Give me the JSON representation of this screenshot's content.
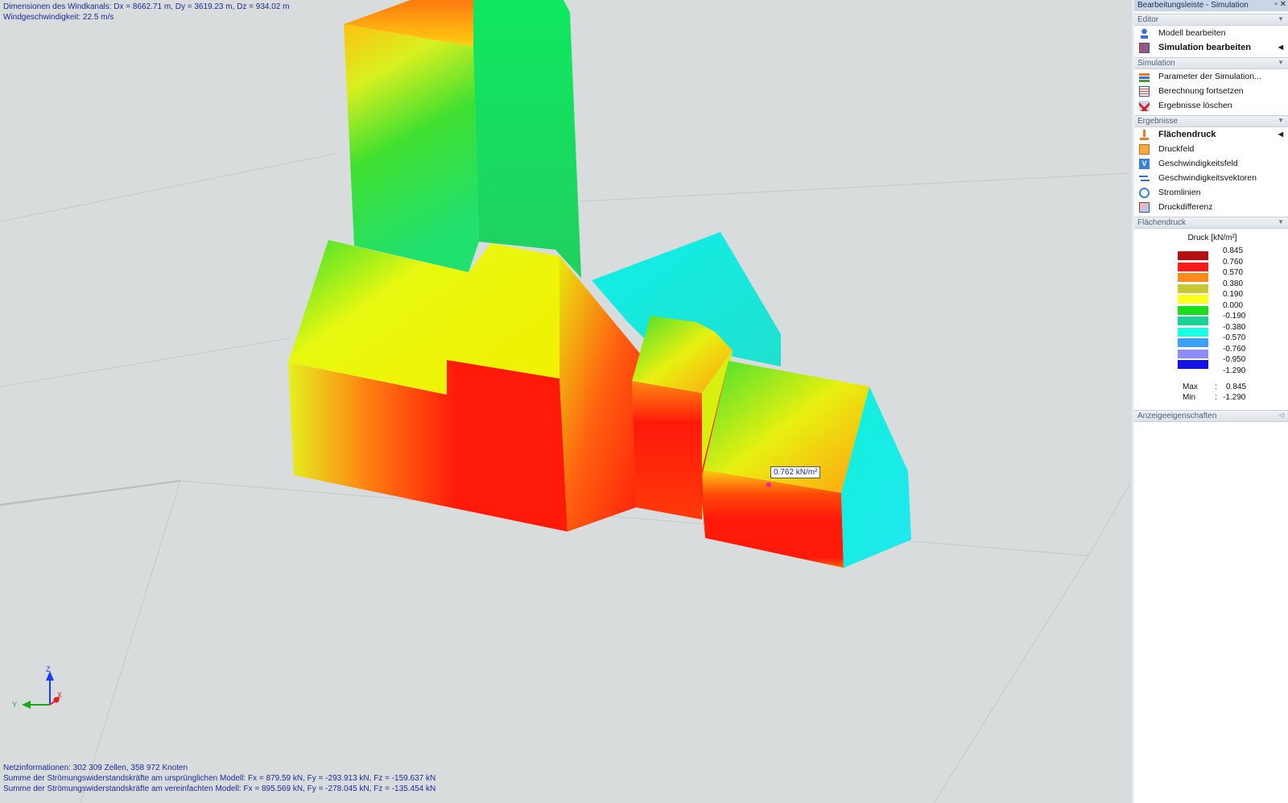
{
  "viewport": {
    "tunnel_dimensions": "Dimensionen des Windkanals: Dx = 8662.71 m, Dy = 3619.23 m, Dz = 934.02 m",
    "wind_speed": "Windgeschwindigkeit: 22.5 m/s",
    "mesh_info": "Netzinformationen: 302 309 Zellen, 358 972 Knoten",
    "drag_original": "Summe der Strömungswiderstandskräfte am ursprünglichen Modell: Fx = 879.59 kN, Fy = -293.913 kN, Fz = -159.637 kN",
    "drag_simplified": "Summe der Strömungswiderstandskräfte am vereinfachten Modell: Fx = 895.569 kN, Fy = -278.045 kN, Fz = -135.454 kN",
    "probe_value": "0.762 kN/m²",
    "axes": {
      "z": "Z",
      "y": "Y",
      "x": "X"
    }
  },
  "panel": {
    "title": "Bearbeitungsleiste - Simulation",
    "controls": "▫ ✕",
    "sections": {
      "editor": {
        "label": "Editor",
        "items": [
          {
            "label": "Modell bearbeiten",
            "icon": "model-edit-icon"
          },
          {
            "label": "Simulation bearbeiten",
            "icon": "simulation-edit-icon"
          }
        ]
      },
      "simulation": {
        "label": "Simulation",
        "items": [
          {
            "label": "Parameter der Simulation...",
            "icon": "parameters-icon"
          },
          {
            "label": "Berechnung fortsetzen",
            "icon": "continue-calc-icon"
          },
          {
            "label": "Ergebnisse löschen",
            "icon": "delete-results-icon"
          }
        ]
      },
      "results": {
        "label": "Ergebnisse",
        "items": [
          {
            "label": "Flächendruck",
            "icon": "surface-pressure-icon"
          },
          {
            "label": "Druckfeld",
            "icon": "pressure-field-icon"
          },
          {
            "label": "Geschwindigkeitsfeld",
            "icon": "velocity-field-icon"
          },
          {
            "label": "Geschwindigkeitsvektoren",
            "icon": "velocity-vectors-icon"
          },
          {
            "label": "Stromlinien",
            "icon": "streamlines-icon"
          },
          {
            "label": "Druckdifferenz",
            "icon": "pressure-difference-icon"
          }
        ]
      },
      "surface_pressure": {
        "label": "Flächendruck",
        "legend_title": "Druck [kN/m²]",
        "legend": [
          {
            "value": "0.845",
            "color": "#b50f14"
          },
          {
            "value": "0.760",
            "color": "#ff1a1a"
          },
          {
            "value": "0.570",
            "color": "#ff8a1a"
          },
          {
            "value": "0.380",
            "color": "#c8c832"
          },
          {
            "value": "0.190",
            "color": "#ffff1a"
          },
          {
            "value": "0.000",
            "color": "#1ade1a"
          },
          {
            "value": "-0.190",
            "color": "#1ad296"
          },
          {
            "value": "-0.380",
            "color": "#1affe6"
          },
          {
            "value": "-0.570",
            "color": "#3ca0ff"
          },
          {
            "value": "-0.760",
            "color": "#8c8cff"
          },
          {
            "value": "-0.950",
            "color": "#1414e6"
          },
          {
            "value": "-1.290",
            "color": ""
          }
        ],
        "max_label": "Max",
        "max_value": "0.845",
        "min_label": "Min",
        "min_value": "-1.290",
        "separator": ":"
      },
      "display": {
        "label": "Anzeigeeigenschaften"
      }
    }
  }
}
